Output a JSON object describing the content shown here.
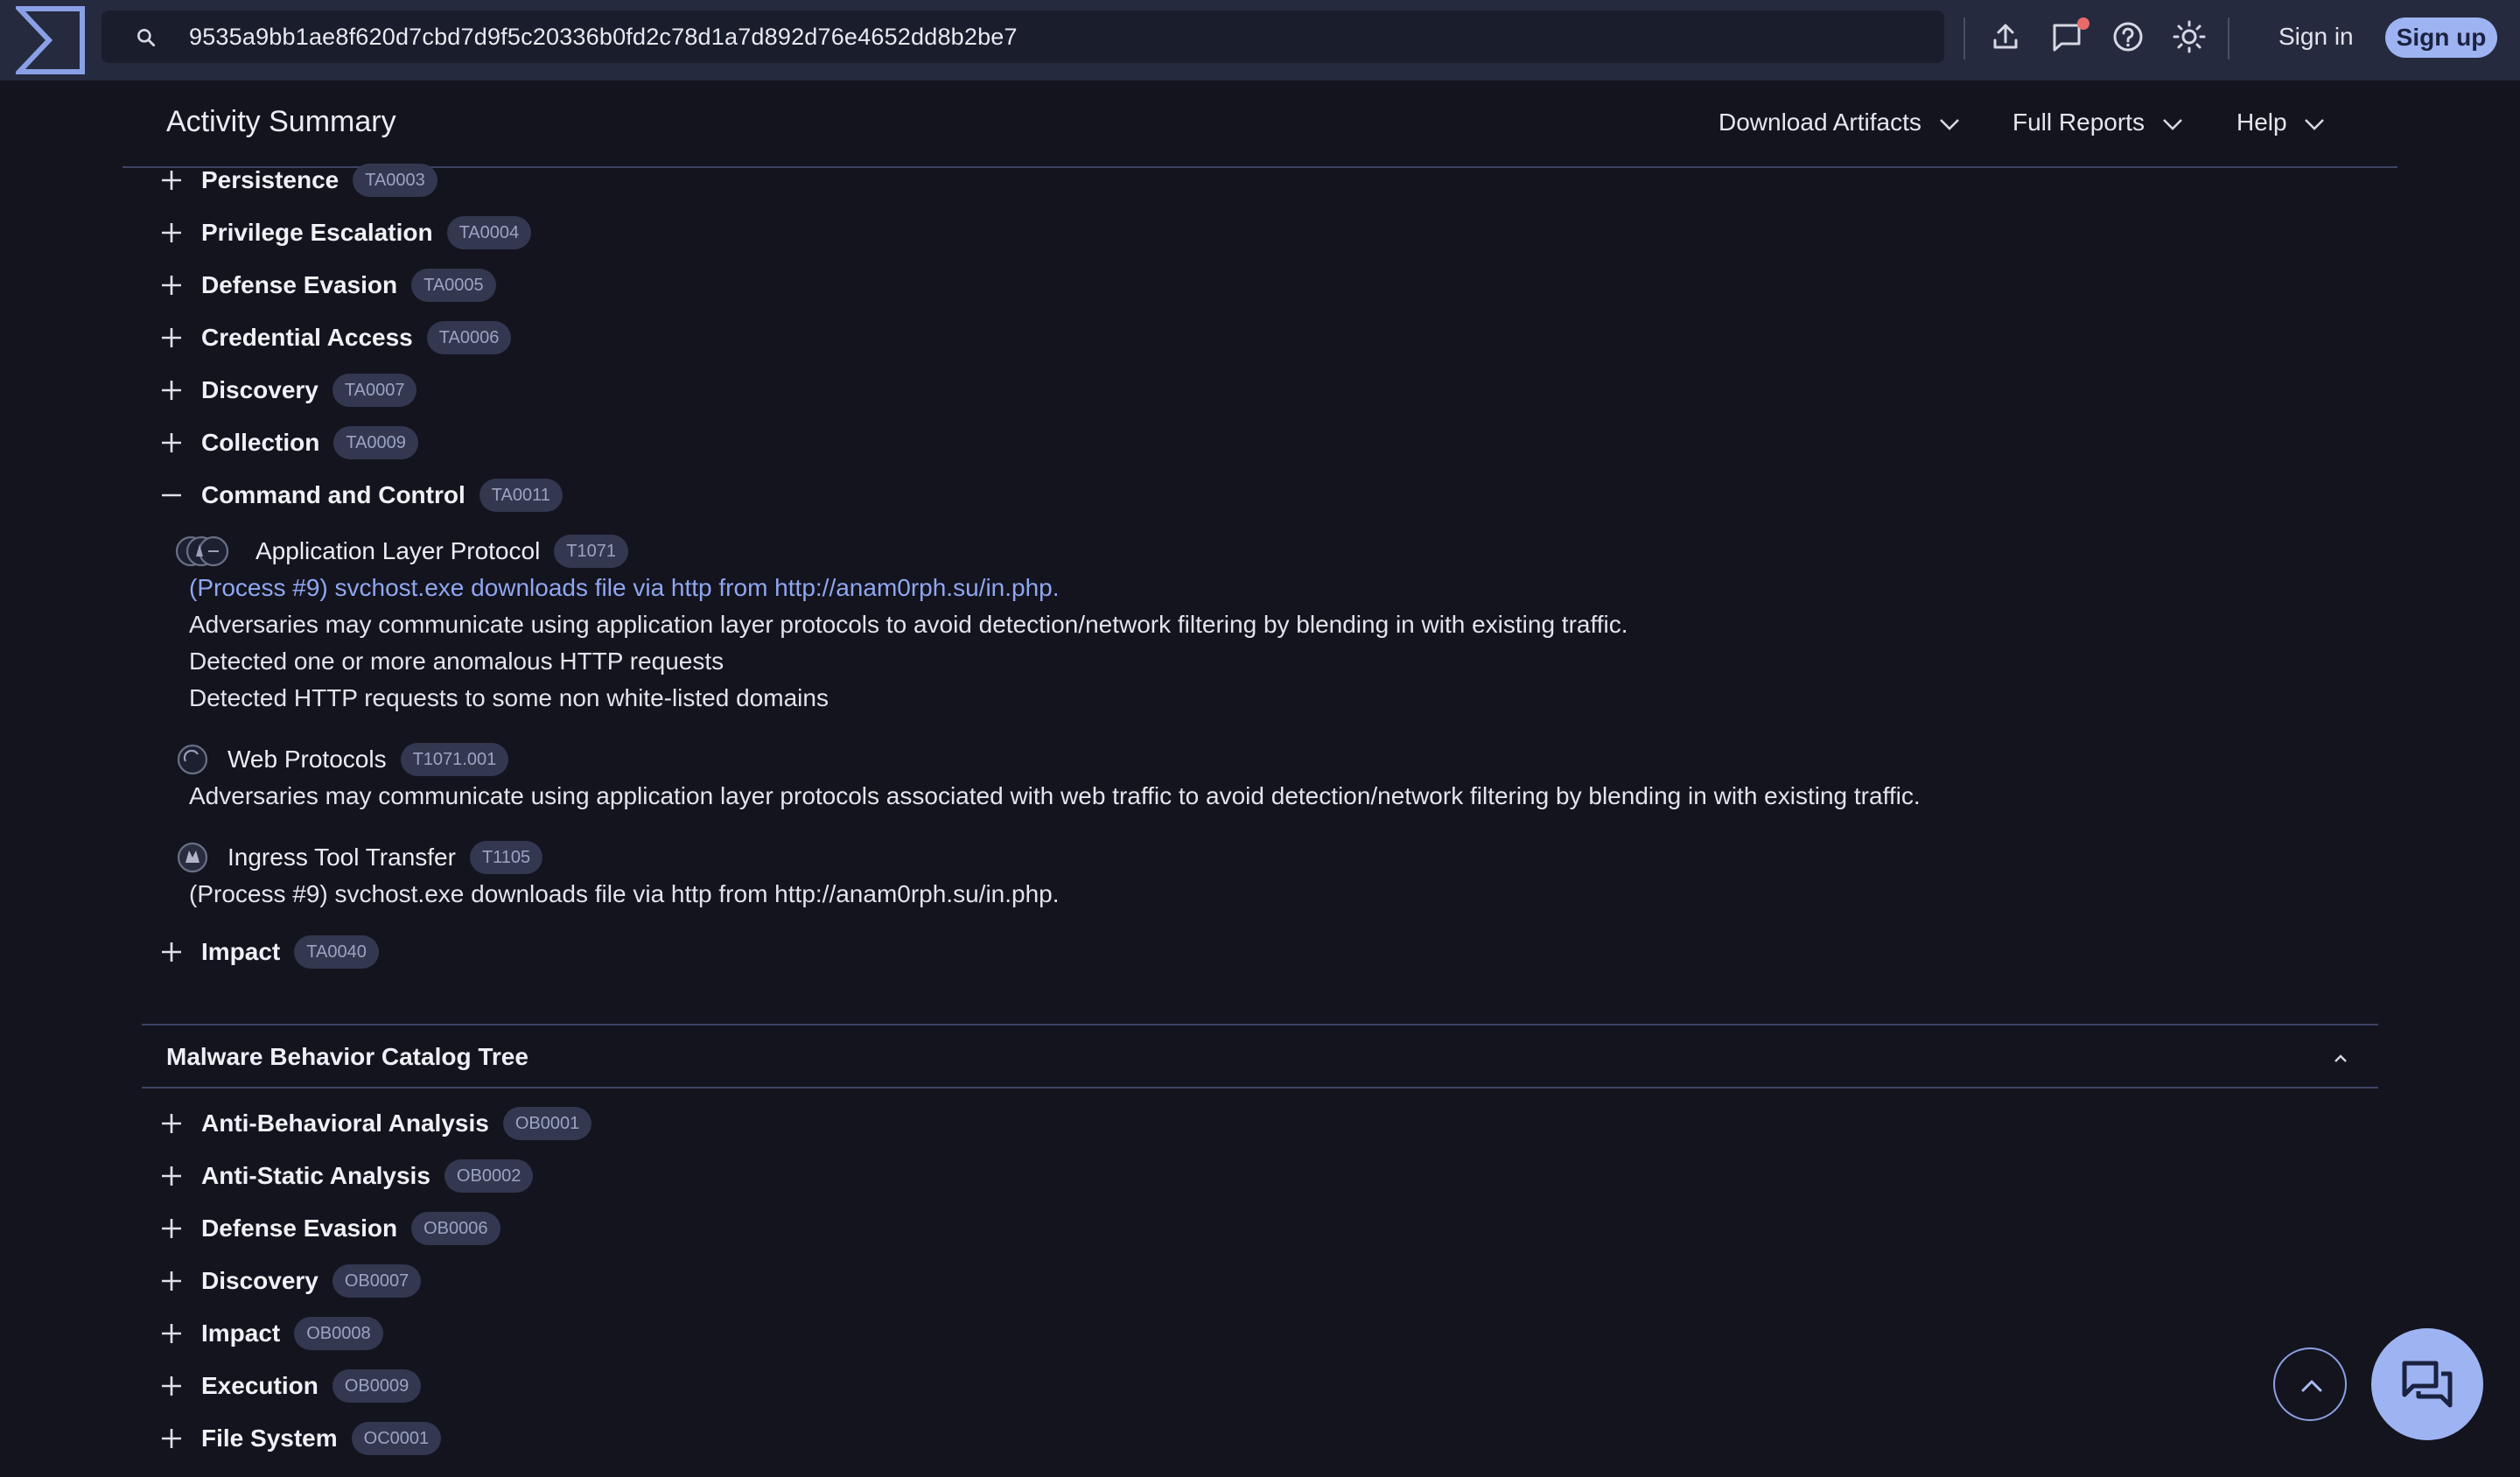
{
  "topbar": {
    "search_value": "9535a9bb1ae8f620d7cbd7d9f5c20336b0fd2c78d1a7d892d76e4652dd8b2be7",
    "sign_in_label": "Sign in",
    "sign_up_label": "Sign up",
    "icons": [
      "upload-icon",
      "comment-icon",
      "help-icon",
      "theme-icon"
    ],
    "accent": "#9eb3f2",
    "notification_color": "#e86a6a"
  },
  "subheader": {
    "title": "Activity Summary",
    "menus": [
      {
        "label": "Download Artifacts"
      },
      {
        "label": "Full Reports"
      },
      {
        "label": "Help"
      }
    ]
  },
  "mitre": {
    "tactics_before": [
      {
        "label": "Persistence",
        "id": "TA0003"
      },
      {
        "label": "Privilege Escalation",
        "id": "TA0004"
      },
      {
        "label": "Defense Evasion",
        "id": "TA0005"
      },
      {
        "label": "Credential Access",
        "id": "TA0006"
      },
      {
        "label": "Discovery",
        "id": "TA0007"
      },
      {
        "label": "Collection",
        "id": "TA0009"
      }
    ],
    "expanded": {
      "label": "Command and Control",
      "id": "TA0011",
      "techniques": [
        {
          "label": "Application Layer Protocol",
          "id": "T1071",
          "lines": [
            "(Process #9) svchost.exe downloads file via http from http://anam0rph.su/in.php.",
            "Adversaries may communicate using application layer protocols to avoid detection/network filtering by blending in with existing traffic.",
            "Detected one or more anomalous HTTP requests",
            "Detected HTTP requests to some non white-listed domains"
          ]
        },
        {
          "label": "Web Protocols",
          "id": "T1071.001",
          "lines": [
            "Adversaries may communicate using application layer protocols associated with web traffic to avoid detection/network filtering by blending in with existing traffic."
          ]
        },
        {
          "label": "Ingress Tool Transfer",
          "id": "T1105",
          "lines": [
            "(Process #9) svchost.exe downloads file via http from http://anam0rph.su/in.php."
          ]
        }
      ]
    },
    "tactics_after": [
      {
        "label": "Impact",
        "id": "TA0040"
      }
    ]
  },
  "mbc": {
    "title": "Malware Behavior Catalog Tree",
    "items": [
      {
        "label": "Anti-Behavioral Analysis",
        "id": "OB0001"
      },
      {
        "label": "Anti-Static Analysis",
        "id": "OB0002"
      },
      {
        "label": "Defense Evasion",
        "id": "OB0006"
      },
      {
        "label": "Discovery",
        "id": "OB0007"
      },
      {
        "label": "Impact",
        "id": "OB0008"
      },
      {
        "label": "Execution",
        "id": "OB0009"
      },
      {
        "label": "File System",
        "id": "OC0001"
      }
    ]
  }
}
